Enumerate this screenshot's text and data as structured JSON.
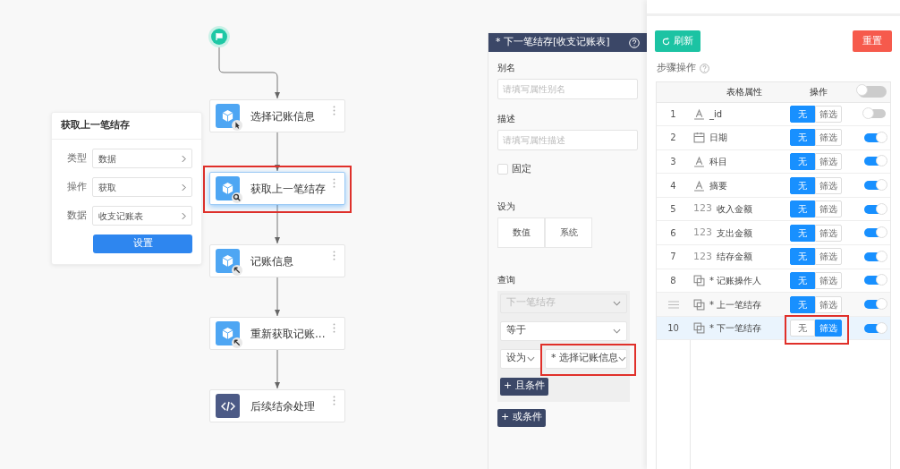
{
  "canvas": {
    "nodes": [
      {
        "label": "选择记账信息",
        "kind": "pointer",
        "selected": false,
        "highlighted": false
      },
      {
        "label": "获取上一笔结存",
        "kind": "search",
        "selected": true,
        "highlighted": true
      },
      {
        "label": "记账信息",
        "kind": "arrow",
        "selected": false,
        "highlighted": false
      },
      {
        "label": "重新获取记账...",
        "kind": "arrow",
        "selected": false,
        "highlighted": false
      },
      {
        "label": "后续结余处理",
        "kind": "code",
        "selected": false,
        "highlighted": false
      }
    ],
    "popup": {
      "title": "获取上一笔结存",
      "fields": [
        {
          "label": "类型",
          "value": "数据"
        },
        {
          "label": "操作",
          "value": "获取"
        },
        {
          "label": "数据",
          "value": "收支记账表"
        }
      ],
      "button": "设置"
    }
  },
  "property_panel": {
    "title": "* 下一笔结存[收支记账表]",
    "alias": {
      "label": "别名",
      "placeholder": "请填写属性别名"
    },
    "description": {
      "label": "描述",
      "placeholder": "请填写属性描述"
    },
    "fixed": {
      "label": "固定",
      "checked": false
    },
    "set_as": {
      "label": "设为",
      "options": [
        "数值",
        "系统"
      ]
    },
    "query": {
      "label": "查询",
      "field": {
        "value": "下一笔结存",
        "disabled": true
      },
      "operator": {
        "value": "等于"
      },
      "source": {
        "value": "设为"
      },
      "target": {
        "value": "* 选择记账信息",
        "highlighted": true
      },
      "and_button": "+ 且条件"
    },
    "or_button": "+ 或条件"
  },
  "steps_panel": {
    "refresh_button": "刷新",
    "reset_button": "重置",
    "section_label": "步骤操作",
    "table": {
      "columns": [
        "表格属性",
        "操作"
      ],
      "header_toggle": {
        "on": false
      },
      "rows": [
        {
          "handle": false,
          "index": "1",
          "kind": "text",
          "name": "_id",
          "options": [
            {
              "label": "无",
              "selected": true
            },
            {
              "label": "筛选",
              "selected": false
            }
          ],
          "on": false,
          "selected": false,
          "highlighted": false
        },
        {
          "handle": false,
          "index": "2",
          "kind": "date",
          "name": "日期",
          "options": [
            {
              "label": "无",
              "selected": true
            },
            {
              "label": "筛选",
              "selected": false
            }
          ],
          "on": true,
          "selected": false,
          "highlighted": false
        },
        {
          "handle": false,
          "index": "3",
          "kind": "text",
          "name": "科目",
          "options": [
            {
              "label": "无",
              "selected": true
            },
            {
              "label": "筛选",
              "selected": false
            }
          ],
          "on": true,
          "selected": false,
          "highlighted": false
        },
        {
          "handle": false,
          "index": "4",
          "kind": "text",
          "name": "摘要",
          "options": [
            {
              "label": "无",
              "selected": true
            },
            {
              "label": "筛选",
              "selected": false
            }
          ],
          "on": true,
          "selected": false,
          "highlighted": false
        },
        {
          "handle": false,
          "index": "5",
          "kind": "number",
          "type_label": "123",
          "name": "收入金额",
          "options": [
            {
              "label": "无",
              "selected": true
            },
            {
              "label": "筛选",
              "selected": false
            }
          ],
          "on": true,
          "selected": false,
          "highlighted": false
        },
        {
          "handle": false,
          "index": "6",
          "kind": "number",
          "type_label": "123",
          "name": "支出金额",
          "options": [
            {
              "label": "无",
              "selected": true
            },
            {
              "label": "筛选",
              "selected": false
            }
          ],
          "on": true,
          "selected": false,
          "highlighted": false
        },
        {
          "handle": false,
          "index": "7",
          "kind": "number",
          "type_label": "123",
          "name": "结存金额",
          "options": [
            {
              "label": "无",
              "selected": true
            },
            {
              "label": "筛选",
              "selected": false
            }
          ],
          "on": true,
          "selected": false,
          "highlighted": false
        },
        {
          "handle": false,
          "index": "8",
          "kind": "relation",
          "name": "* 记账操作人",
          "options": [
            {
              "label": "无",
              "selected": true
            },
            {
              "label": "筛选",
              "selected": false
            }
          ],
          "on": true,
          "selected": false,
          "highlighted": false
        },
        {
          "handle": true,
          "kind": "relation",
          "name": "* 上一笔结存",
          "options": [
            {
              "label": "无",
              "selected": true
            },
            {
              "label": "筛选",
              "selected": false
            }
          ],
          "on": true,
          "selected": false,
          "highlighted": false
        },
        {
          "handle": false,
          "index": "10",
          "kind": "relation",
          "name": "* 下一笔结存",
          "options": [
            {
              "label": "无",
              "selected": false
            },
            {
              "label": "筛选",
              "selected": true
            }
          ],
          "on": true,
          "selected": true,
          "highlighted": true
        }
      ]
    }
  }
}
